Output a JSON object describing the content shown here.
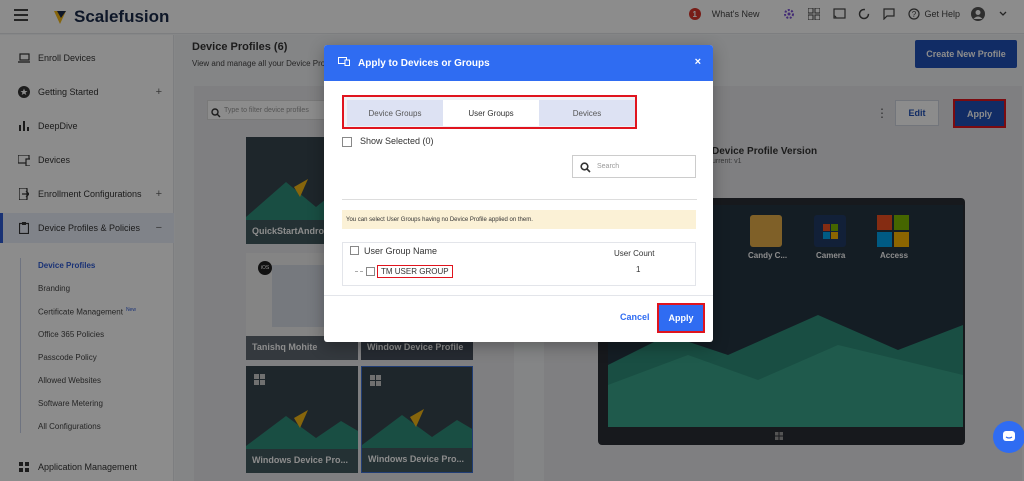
{
  "app": {
    "name": "Scalefusion"
  },
  "topbar": {
    "whats_new_count": "1",
    "whats_new": "What's New",
    "get_help": "Get Help"
  },
  "sidebar": {
    "items": [
      {
        "label": "Enroll Devices",
        "icon": "laptop-icon"
      },
      {
        "label": "Getting Started",
        "icon": "star-icon",
        "expander": "+"
      },
      {
        "label": "DeepDive",
        "icon": "bar-chart-icon"
      },
      {
        "label": "Devices",
        "icon": "devices-icon"
      },
      {
        "label": "Enrollment Configurations",
        "icon": "enrollment-icon",
        "expander": "+"
      },
      {
        "label": "Device Profiles & Policies",
        "icon": "clipboard-icon",
        "expander": "−"
      },
      {
        "label": "Application Management",
        "icon": "grid-icon"
      }
    ],
    "sub_items": [
      "Device Profiles",
      "Branding",
      "Certificate Management",
      "Office 365 Policies",
      "Passcode Policy",
      "Allowed Websites",
      "Software Metering",
      "All Configurations"
    ],
    "new_badge": "New"
  },
  "page": {
    "title": "Device Profiles (6)",
    "subtitle": "View and manage all your Device Profi",
    "create_button": "Create New Profile",
    "filter_placeholder": "Type to filter device profiles",
    "cards": [
      "QuickStartAndro",
      "Tanishq Mohite",
      "Window Device Profile",
      "Windows Device Pro...",
      "Windows Device Pro..."
    ],
    "edit_button": "Edit",
    "apply_button": "Apply",
    "version_title": "Device Profile Version",
    "version_sub": "urrent: v1",
    "apps": [
      "Candy C...",
      "Camera",
      "Access"
    ],
    "avatar_text": "iOS"
  },
  "modal": {
    "title": "Apply to Devices or Groups",
    "close": "×",
    "tabs": [
      "Device Groups",
      "User Groups",
      "Devices"
    ],
    "selected_tab": "User Groups",
    "show_selected": "Show Selected (0)",
    "search_placeholder": "Search",
    "notice": "You can select User Groups having no Device Profile applied on them.",
    "col_name": "User Group Name",
    "col_count": "User Count",
    "rows": [
      {
        "name": "TM USER GROUP",
        "count": "1"
      }
    ],
    "cancel": "Cancel",
    "apply": "Apply"
  },
  "colors": {
    "primary": "#2f6cf2",
    "brand_dark": "#2050b8",
    "highlight": "#e0141e",
    "notice_bg": "#fbf1d6"
  }
}
